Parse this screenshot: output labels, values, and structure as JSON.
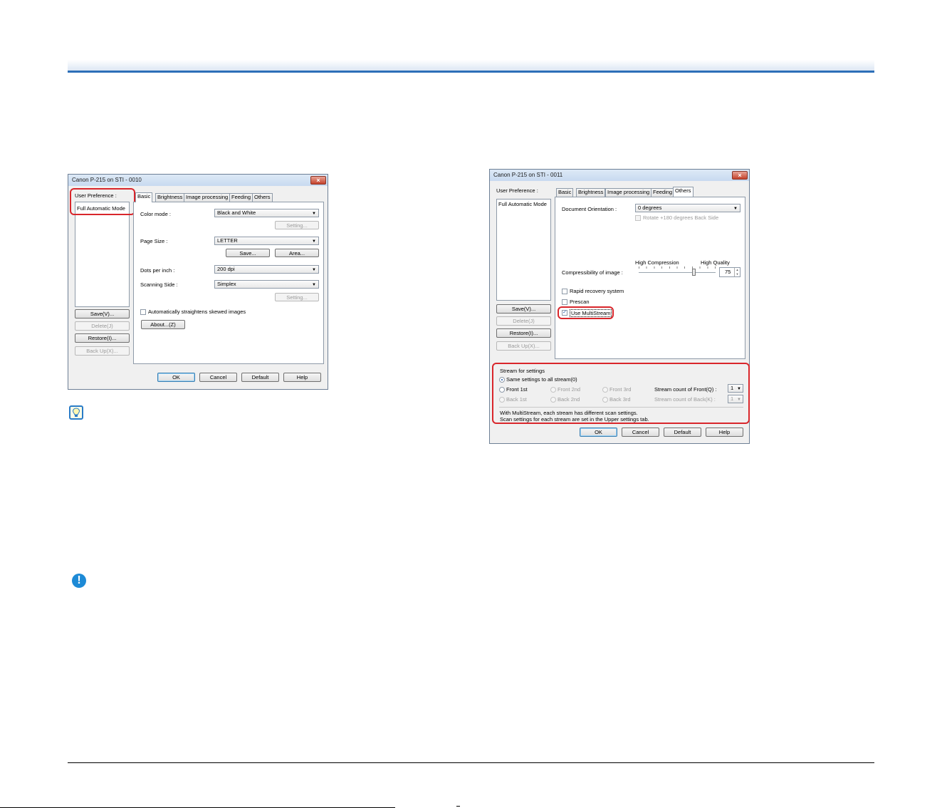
{
  "left_dialog": {
    "title": "Canon P-215 on STI - 0010",
    "close_glyph": "×",
    "user_preference_label": "User Preference :",
    "preference_item": "Full Automatic Mode",
    "side_buttons": [
      "Save(V)...",
      "Delete(J)",
      "Restore(I)...",
      "Back Up(X)..."
    ],
    "tabs": [
      "Basic",
      "Brightness",
      "Image processing",
      "Feeding",
      "Others"
    ],
    "active_tab": "Basic",
    "color_mode_label": "Color mode :",
    "color_mode_value": "Black and White",
    "setting_button": "Setting...",
    "page_size_label": "Page Size :",
    "page_size_value": "LETTER",
    "save_button": "Save...",
    "area_button": "Area...",
    "dpi_label": "Dots per inch :",
    "dpi_value": "200 dpi",
    "scanning_side_label": "Scanning Side :",
    "scanning_side_value": "Simplex",
    "setting_button_2": "Setting...",
    "straighten_label": "Automatically straightens skewed images",
    "about_button": "About...(Z)",
    "footer_buttons": [
      "OK",
      "Cancel",
      "Default",
      "Help"
    ]
  },
  "right_dialog": {
    "title": "Canon P-215 on STI - 0011",
    "close_glyph": "×",
    "user_preference_label": "User Preference :",
    "preference_item": "Full Automatic Mode",
    "side_buttons": [
      "Save(V)...",
      "Delete(J)",
      "Restore(I)...",
      "Back Up(X)..."
    ],
    "tabs": [
      "Basic",
      "Brightness",
      "Image processing",
      "Feeding",
      "Others"
    ],
    "active_tab": "Others",
    "orientation_label": "Document Orientation :",
    "orientation_value": "0 degrees",
    "rotate_label": "Rotate +180 degrees Back Side",
    "high_compression": "High Compression",
    "high_quality": "High Quality",
    "compressibility_label": "Compressibility of image :",
    "compressibility_value": "75",
    "rapid_recovery_label": "Rapid recovery system",
    "prescan_label": "Prescan",
    "multistream_label": "Use MultiStream",
    "stream_group_label": "Stream for settings",
    "same_settings_label": "Same settings to all stream(0)",
    "front_options": [
      "Front 1st",
      "Front 2nd",
      "Front 3rd"
    ],
    "back_options": [
      "Back 1st",
      "Back 2nd",
      "Back 3rd"
    ],
    "stream_count_front_label": "Stream count of Front(Q) :",
    "stream_count_front_value": "1",
    "stream_count_back_label": "Stream count of Back(K) :",
    "stream_count_back_value": "1",
    "info_line_1": "With MultiStream, each stream has different scan settings.",
    "info_line_2": "Scan settings for each stream are set in the Upper settings tab.",
    "footer_buttons": [
      "OK",
      "Cancel",
      "Default",
      "Help"
    ]
  },
  "icons": {
    "tip": "lightbulb-hint-icon",
    "warning": "exclamation-important-icon"
  }
}
